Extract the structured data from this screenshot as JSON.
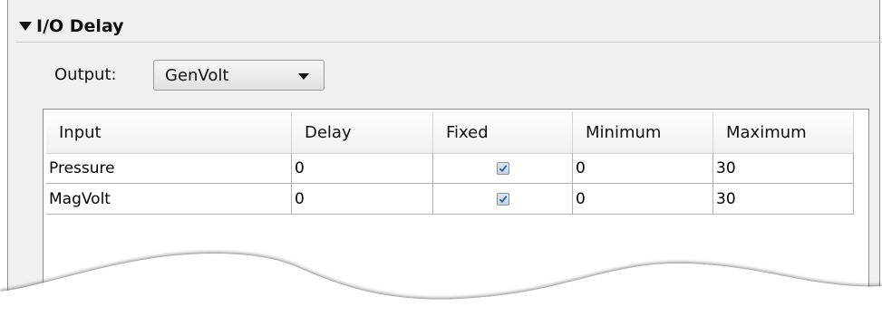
{
  "section": {
    "title": "I/O Delay"
  },
  "output": {
    "label": "Output:",
    "selected": "GenVolt"
  },
  "table": {
    "columns": [
      "Input",
      "Delay",
      "Fixed",
      "Minimum",
      "Maximum"
    ],
    "rows": [
      {
        "input": "Pressure",
        "delay": "0",
        "fixed": true,
        "minimum": "0",
        "maximum": "30"
      },
      {
        "input": "MagVolt",
        "delay": "0",
        "fixed": true,
        "minimum": "0",
        "maximum": "30"
      }
    ]
  },
  "colors": {
    "panel_bg": "#f0f0f0",
    "checkbox_check": "#3a5a96"
  }
}
